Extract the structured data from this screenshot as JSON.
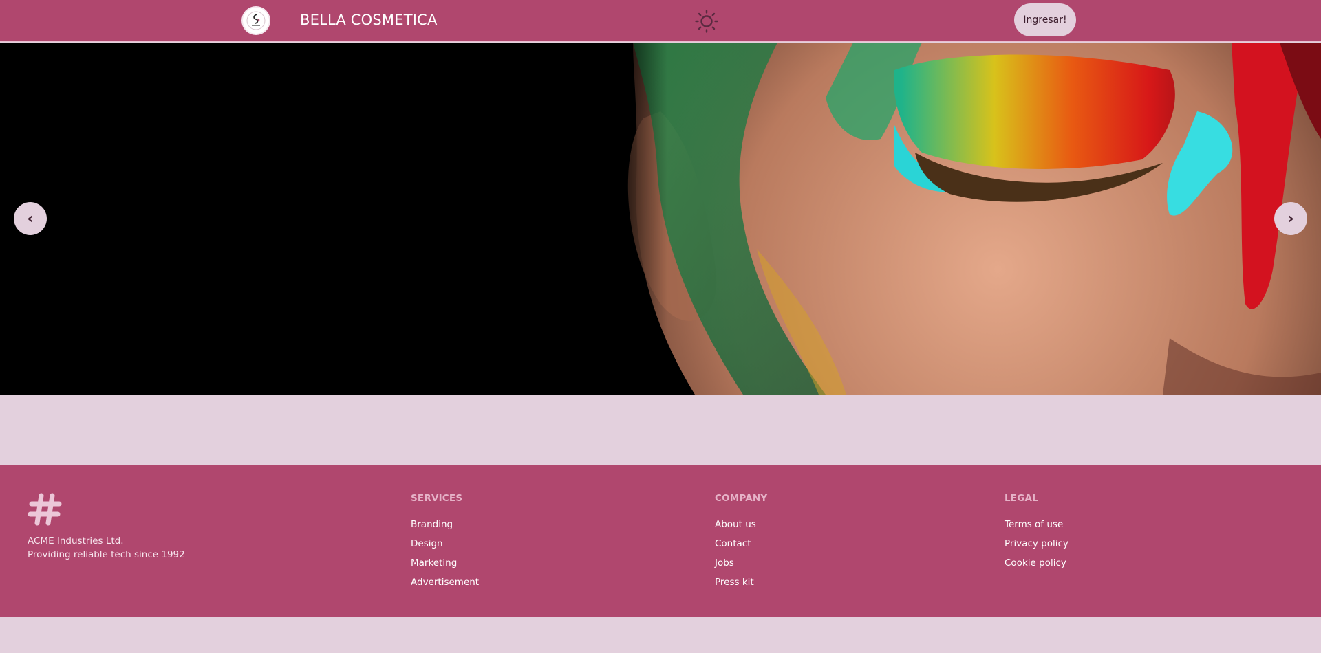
{
  "header": {
    "brand_name": "BELLA COSMETICA",
    "logo_icon": "bella-logo-icon",
    "theme_icon": "sun-icon",
    "login_label": "Ingresar!"
  },
  "carousel": {
    "prev_label": "‹",
    "next_label": "›",
    "image": "colorful-eye-makeup-photo"
  },
  "footer": {
    "brand_icon": "hashtag-icon",
    "company_name": "ACME Industries Ltd.",
    "tagline": "Providing reliable tech since 1992",
    "services": {
      "title": "Services",
      "links": [
        "Branding",
        "Design",
        "Marketing",
        "Advertisement"
      ]
    },
    "company": {
      "title": "Company",
      "links": [
        "About us",
        "Contact",
        "Jobs",
        "Press kit"
      ]
    },
    "legal": {
      "title": "Legal",
      "links": [
        "Terms of use",
        "Privacy policy",
        "Cookie policy"
      ]
    }
  },
  "colors": {
    "primary": "#b0476e",
    "base": "#e3d0dd",
    "text_dark": "#3c1d2d"
  }
}
